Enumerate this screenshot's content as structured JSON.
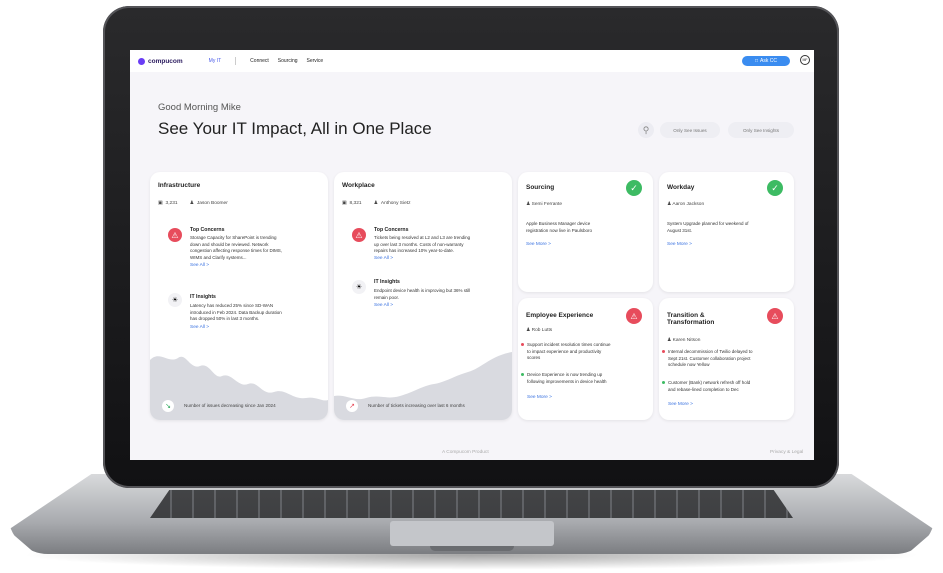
{
  "nav": {
    "brand": "compucom",
    "items": [
      "My IT",
      "Connect",
      "Sourcing",
      "Service"
    ],
    "ask_button": "Ask CC",
    "avatar_initials": "MF"
  },
  "hero": {
    "greeting": "Good Morning Mike",
    "headline": "See Your IT Impact, All in One Place",
    "filter_issues": "Only See Issues",
    "filter_insights": "Only See Insights"
  },
  "infrastructure": {
    "title": "Infrastructure",
    "count": "3,231",
    "owner": "Jason Boomer",
    "concerns_title": "Top Concerns",
    "concerns_body": [
      "Storage Capacity for SharePoint is trending",
      "down and should be reviewed. Network",
      "congestion affecting response times for DIMS,",
      "WIMS and Clarify systems..."
    ],
    "concerns_link": "See All >",
    "insights_title": "IT Insights",
    "insights_body": [
      "Latency has reduced 25% since SD-WAN",
      "introduced in Feb 2024. Data Backup duration",
      "has dropped 50% in last 3 months."
    ],
    "insights_link": "See All >",
    "trend_text": "Number of issues decreasing since Jan 2024"
  },
  "workplace": {
    "title": "Workplace",
    "count": "8,321",
    "owner": "Anthony Sietz",
    "concerns_title": "Top Concerns",
    "concerns_body": [
      "Tickets being resolved at L2 and L3 are trending",
      "up over last 3 months. Costs of non-warranty",
      "repairs has increased 10% year-to-date."
    ],
    "concerns_link": "See All >",
    "insights_title": "IT Insights",
    "insights_body": [
      "Endpoint device health is improving but 36% still",
      "remain poor."
    ],
    "insights_link": "See All >",
    "trend_text": "Number of tickets increasing over last 6 months"
  },
  "sourcing": {
    "title": "Sourcing",
    "owner": "Semi Ferrante",
    "body": [
      "Apple Business Manager device",
      "registration now live in Paulsboro"
    ],
    "link": "See More >"
  },
  "workday": {
    "title": "Workday",
    "owner": "Aaron Jackson",
    "body": [
      "System Upgrade planned for weekend of",
      "August 31st."
    ],
    "link": "See More >"
  },
  "employee": {
    "title": "Employee Experience",
    "owner": "Rob Lutts",
    "bullet1": [
      "Support incident resolution times continue",
      "to impact experience and productivity",
      "scores"
    ],
    "bullet2": [
      "Device Experience is now trending up",
      "following improvements in device health"
    ],
    "link": "See More >"
  },
  "transition": {
    "title_line1": "Transition &",
    "title_line2": "Transformation",
    "owner": "Karen Nitson",
    "bullet1": [
      "Internal decommission of Twilio delayed to",
      "Sept 21st. Customer collaboration project",
      "schedule now Yellow"
    ],
    "bullet2": [
      "Customer (Bank) network refresh off hold",
      "and rebase-lined completion to Dec"
    ],
    "link": "See More >"
  },
  "footer": {
    "center": "A Compucom Product",
    "right": "Privacy & Legal"
  },
  "colors": {
    "accent": "#3a8cf0",
    "alert": "#e74c5c",
    "ok": "#3dbb63",
    "link": "#3a72e0"
  }
}
